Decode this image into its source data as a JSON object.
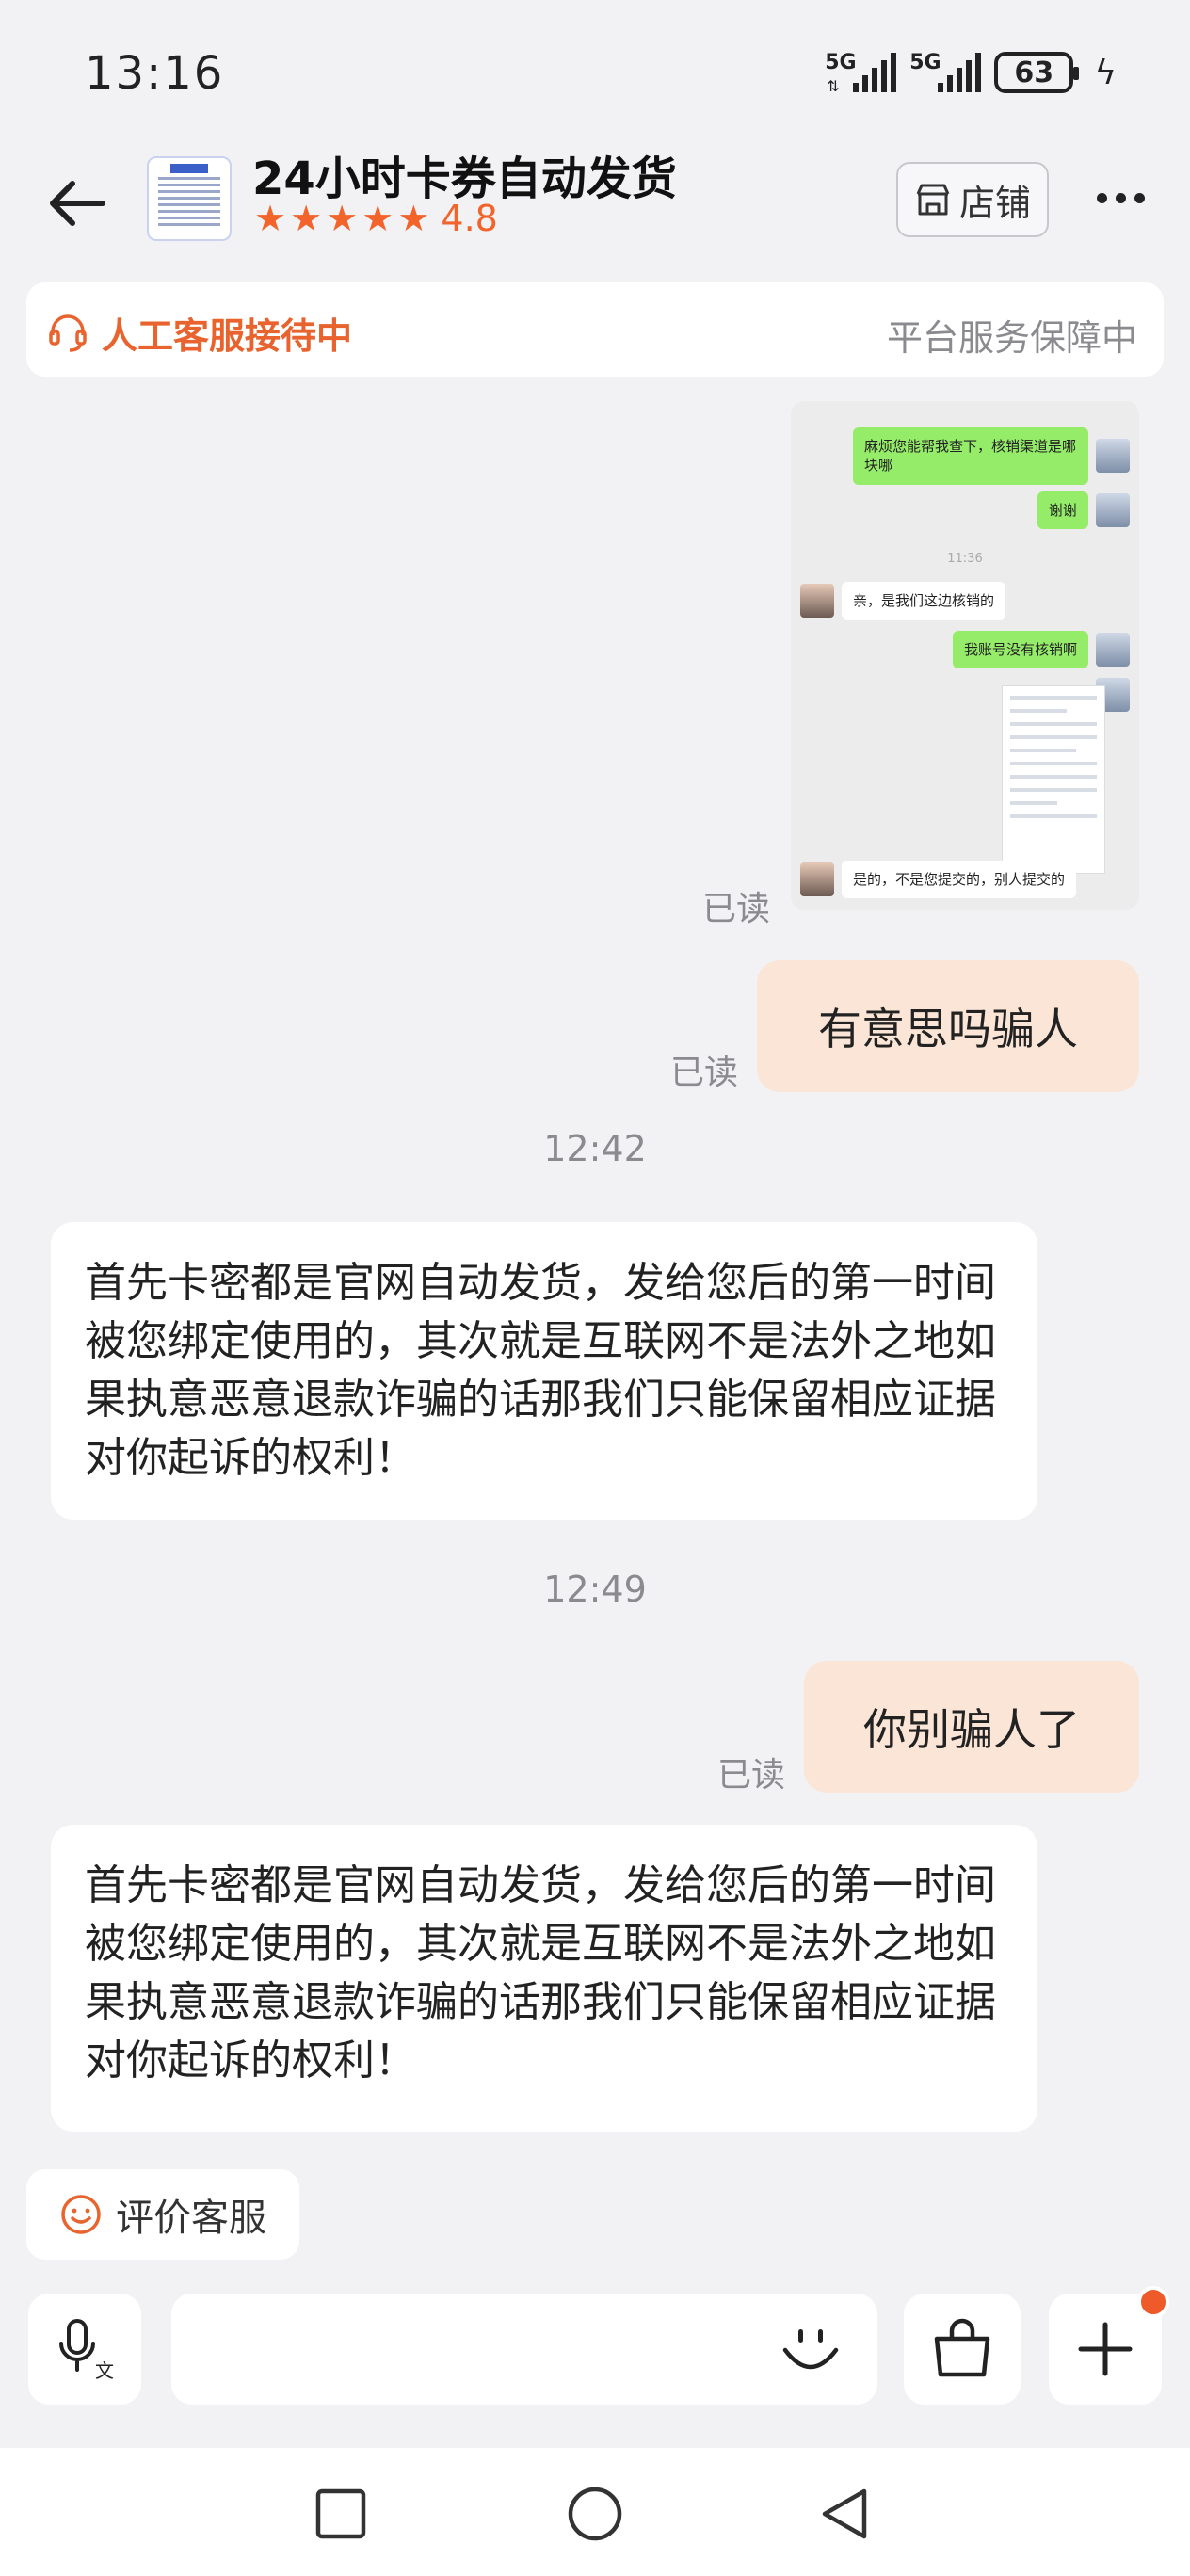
{
  "status_bar": {
    "time": "13:16",
    "signal_1": "5G",
    "signal_2": "5G",
    "battery": "63"
  },
  "header": {
    "shop_name": "24小时卡券自动发货",
    "rating": "4.8",
    "store_label": "店铺"
  },
  "service": {
    "status": "人工客服接待中",
    "guarantee": "平台服务保障中"
  },
  "screenshot_image": {
    "messages": [
      {
        "side": "right",
        "text": "麻烦您能帮我查下，核销渠道是哪块哪"
      },
      {
        "side": "right",
        "text": "谢谢"
      },
      {
        "side": "time",
        "text": "11:36"
      },
      {
        "side": "left",
        "text": "亲，是我们这边核销的"
      },
      {
        "side": "right",
        "text": "我账号没有核销啊"
      },
      {
        "side": "left",
        "text": "是的，不是您提交的，别人提交的"
      }
    ]
  },
  "messages": [
    {
      "side": "right",
      "read": "已读",
      "text": "有意思吗骗人"
    },
    {
      "time": "12:42"
    },
    {
      "side": "left",
      "text": "首先卡密都是官网自动发货，发给您后的第一时间被您绑定使用的，其次就是互联网不是法外之地如果执意恶意退款诈骗的话那我们只能保留相应证据对你起诉的权利！"
    },
    {
      "time": "12:49"
    },
    {
      "side": "right",
      "read": "已读",
      "text": "你别骗人了"
    },
    {
      "side": "left",
      "text": "首先卡密都是官网自动发货，发给您后的第一时间被您绑定使用的，其次就是互联网不是法外之地如果执意恶意退款诈骗的话那我们只能保留相应证据对你起诉的权利！"
    }
  ],
  "image_read": "已读",
  "rate_chip": "评价客服",
  "colors": {
    "accent": "#e8632e",
    "bubble_right": "#fbe5d6",
    "background": "#f2f2f5"
  }
}
